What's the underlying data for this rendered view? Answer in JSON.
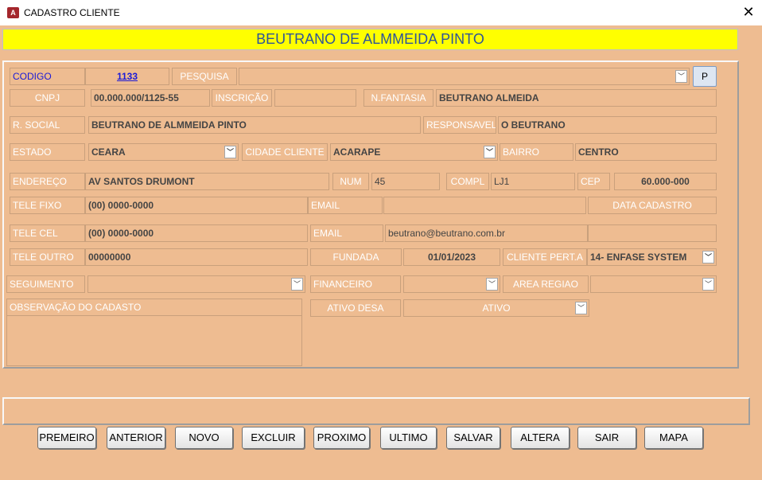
{
  "window": {
    "title": "CADASTRO CLIENTE",
    "app_icon_letter": "A",
    "close_symbol": "✕"
  },
  "header": {
    "client_name": "BEUTRANO DE ALMMEIDA PINTO"
  },
  "fields": {
    "codigo_label": "CODIGO",
    "codigo_value": "1133",
    "pesquisa_label": "PESQUISA",
    "pesquisa_value": "",
    "p_button": "P",
    "cnpj_label": "CNPJ",
    "cnpj_value": "00.000.000/1125-55",
    "inscricao_label": "INSCRIÇÃO",
    "inscricao_value": "",
    "nfantasia_label": "N.FANTASIA",
    "nfantasia_value": "BEUTRANO ALMEIDA",
    "rsocial_label": "R. SOCIAL",
    "rsocial_value": "BEUTRANO DE ALMMEIDA PINTO",
    "responsavel_label": "RESPONSAVEL",
    "responsavel_value": "O BEUTRANO",
    "estado_label": "ESTADO",
    "estado_value": "CEARA",
    "cidade_label": "CIDADE CLIENTE",
    "cidade_value": "ACARAPE",
    "bairro_label": "BAIRRO",
    "bairro_value": "CENTRO",
    "endereco_label": "ENDEREÇO",
    "endereco_value": "AV SANTOS DRUMONT",
    "num_label": "NUM",
    "num_value": "45",
    "compl_label": "COMPL",
    "compl_value": "LJ1",
    "cep_label": "CEP",
    "cep_value": "60.000-000",
    "telefixo_label": "TELE FIXO",
    "telefixo_value": "(00) 0000-0000",
    "email1_label": "EMAIL",
    "email1_value": "",
    "datacadastro_label": "DATA CADASTRO",
    "telecel_label": "TELE CEL",
    "telecel_value": "(00) 0000-0000",
    "email2_label": "EMAIL",
    "email2_value": "beutrano@beutrano.com.br",
    "teleoutro_label": "TELE OUTRO",
    "teleoutro_value": "00000000",
    "fundada_label": "FUNDADA",
    "fundada_value": "01/01/2023",
    "clientepert_label": "CLIENTE PERT.A",
    "clientepert_value": "14- ENFASE SYSTEM",
    "seguimento_label": "SEGUIMENTO",
    "seguimento_value": "",
    "financeiro_label": "FINANCEIRO",
    "financeiro_value": "",
    "arearegiao_label": "AREA REGIAO",
    "arearegiao_value": "",
    "observacao_label": "OBSERVAÇÃO DO CADASTO",
    "observacao_value": "",
    "ativo_label": "ATIVO DESA",
    "ativo_value": "ATIVO"
  },
  "dropdown_arrow": "﹀",
  "buttons": [
    "PREMEIRO",
    "ANTERIOR",
    "NOVO",
    "EXCLUIR",
    "PROXIMO",
    "ULTIMO",
    "SALVAR",
    "ALTERA",
    "SAIR",
    "MAPA"
  ],
  "colors": {
    "background": "#eebc91",
    "header": "#ffff00",
    "header_text": "#2f5597",
    "label_text": "#ffffff"
  }
}
